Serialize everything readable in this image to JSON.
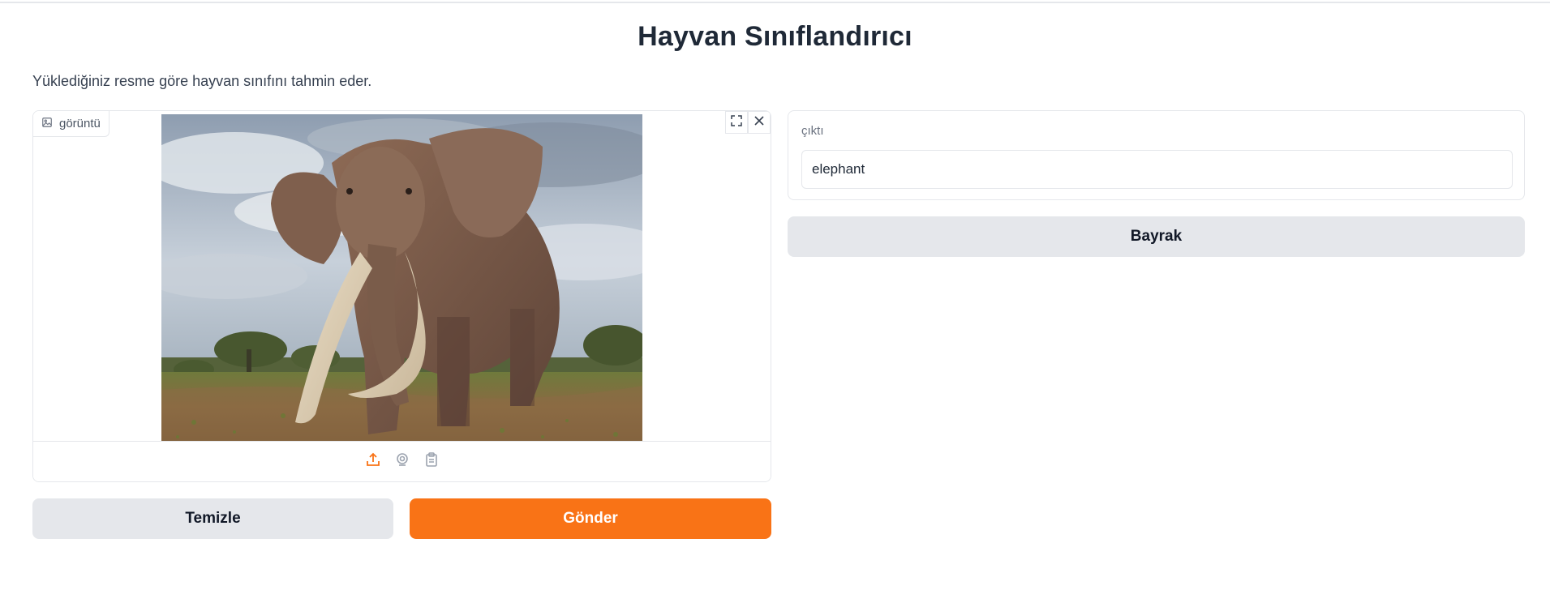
{
  "app": {
    "title": "Hayvan Sınıflandırıcı",
    "description": "Yüklediğiniz resme göre hayvan sınıfını tahmin eder."
  },
  "image_input": {
    "label": "görüntü",
    "label_icon": "image-icon",
    "image_alt": "elephant photo",
    "tools": [
      {
        "name": "fullscreen-icon"
      },
      {
        "name": "close-icon"
      }
    ],
    "sources": [
      {
        "name": "upload-icon",
        "active": true
      },
      {
        "name": "webcam-icon",
        "active": false
      },
      {
        "name": "clipboard-icon",
        "active": false
      }
    ]
  },
  "buttons": {
    "clear": "Temizle",
    "submit": "Gönder",
    "flag": "Bayrak"
  },
  "output": {
    "label": "çıktı",
    "value": "elephant"
  },
  "colors": {
    "accent": "#f97316",
    "secondary_button": "#e5e7eb",
    "border": "#e5e7eb"
  }
}
